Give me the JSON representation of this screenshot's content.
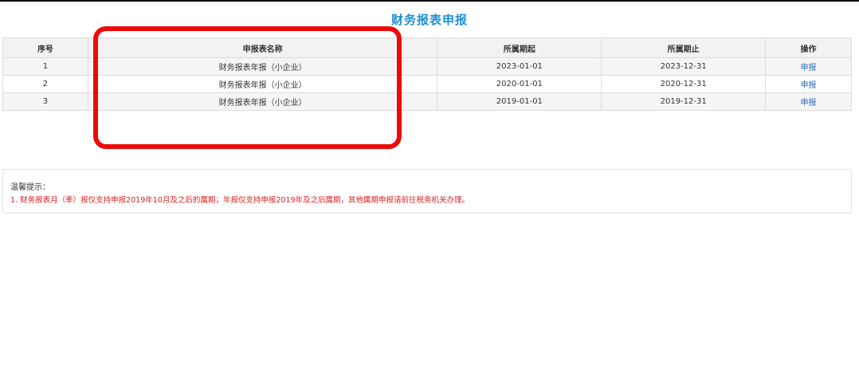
{
  "page_title": "财务报表申报",
  "table": {
    "headers": [
      "序号",
      "申报表名称",
      "所属期起",
      "所属期止",
      "操作"
    ],
    "rows": [
      {
        "index": "1",
        "name": "财务报表年报（小企业）",
        "start": "2023-01-01",
        "end": "2023-12-31",
        "action": "申报"
      },
      {
        "index": "2",
        "name": "财务报表年报（小企业）",
        "start": "2020-01-01",
        "end": "2020-12-31",
        "action": "申报"
      },
      {
        "index": "3",
        "name": "财务报表年报（小企业）",
        "start": "2019-01-01",
        "end": "2019-12-31",
        "action": "申报"
      }
    ]
  },
  "notice": {
    "title": "温馨提示：",
    "items": [
      "1. 财务报表月（季）报仅支持申报2019年10月及之后的属期；年报仅支持申报2019年及之后属期，其他属期申报请前往税务机关办理。"
    ]
  },
  "colors": {
    "title": "#1e8fd6",
    "link": "#2a6ebb",
    "highlight": "#ee0a0a",
    "notice_text": "#e02020"
  }
}
